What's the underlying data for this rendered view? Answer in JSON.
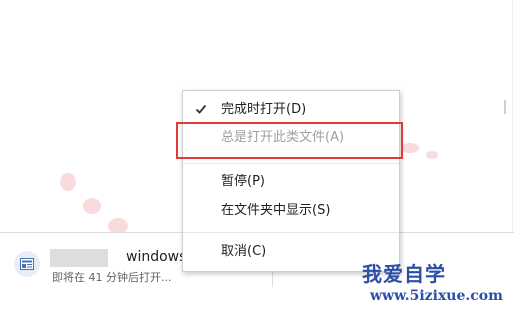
{
  "download": {
    "file_name": "windows.",
    "status_text": "即将在 41 分钟后打开..."
  },
  "context_menu": {
    "items": [
      {
        "label": "完成时打开(D)",
        "checked": true,
        "enabled": true
      },
      {
        "label": "总是打开此类文件(A)",
        "checked": false,
        "enabled": false
      },
      {
        "label": "暂停(P)",
        "checked": false,
        "enabled": true
      },
      {
        "label": "在文件夹中显示(S)",
        "checked": false,
        "enabled": true
      },
      {
        "label": "取消(C)",
        "checked": false,
        "enabled": true
      }
    ]
  },
  "annotation": {
    "highlight_color": "#e03a3a"
  },
  "watermark": {
    "line1": "我爱自学",
    "line2": "www.5izixue.com",
    "color": "#2b4fa8"
  },
  "icons": {
    "check": "check-icon",
    "file": "file-icon"
  }
}
